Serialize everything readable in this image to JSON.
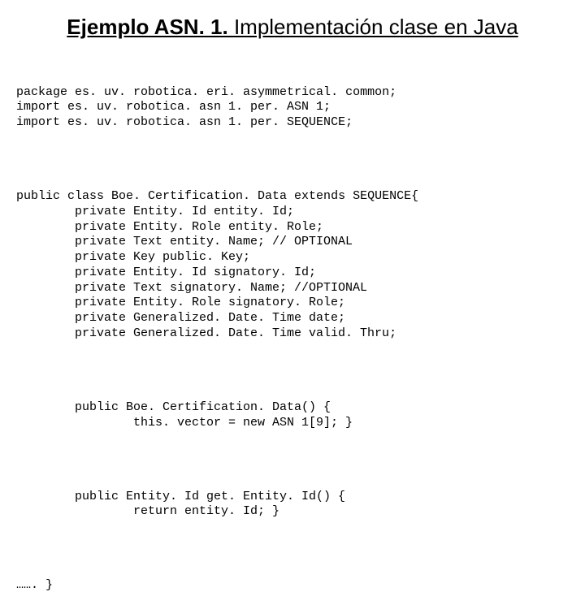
{
  "title": {
    "bold": "Ejemplo ASN. 1. ",
    "plain": "Implementación clase en Java"
  },
  "code": {
    "pkg": "package es. uv. robotica. eri. asymmetrical. common;",
    "imp1": "import es. uv. robotica. asn 1. per. ASN 1;",
    "imp2": "import es. uv. robotica. asn 1. per. SEQUENCE;",
    "cls": "public class Boe. Certification. Data extends SEQUENCE{",
    "f0": "private Entity. Id entity. Id;",
    "f1": "private Entity. Role entity. Role;",
    "f2": "private Text entity. Name; // OPTIONAL",
    "f3": "private Key public. Key;",
    "f4": "private Entity. Id signatory. Id;",
    "f5": "private Text signatory. Name; //OPTIONAL",
    "f6": "private Entity. Role signatory. Role;",
    "f7": "private Generalized. Date. Time date;",
    "f8": "private Generalized. Date. Time valid. Thru;",
    "ctor1": "public Boe. Certification. Data() {",
    "ctor2": "this. vector = new ASN 1[9]; }",
    "get1": "public Entity. Id get. Entity. Id() {",
    "get2": "return entity. Id; }",
    "end": "……. }"
  }
}
